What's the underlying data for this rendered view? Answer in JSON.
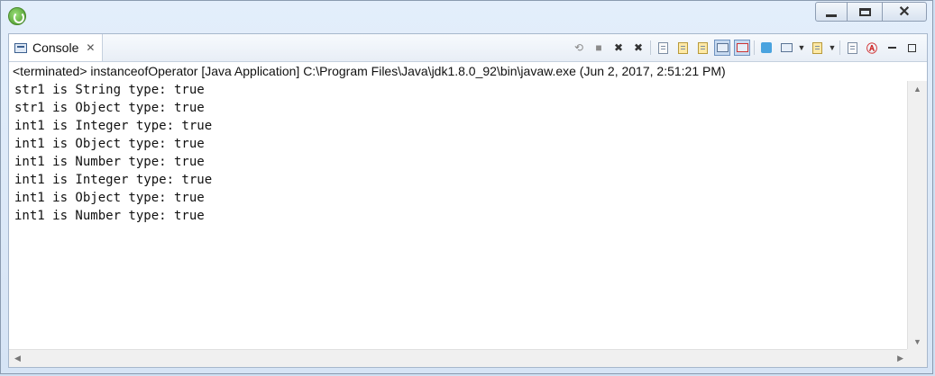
{
  "window": {
    "controls": [
      "minimize",
      "maximize",
      "close"
    ]
  },
  "tab": {
    "label": "Console",
    "close": "✕"
  },
  "toolbar": {
    "icons": [
      "remove-launch-icon",
      "terminate-icon",
      "remove-all-terminated-icon",
      "remove-launch-x-icon",
      "clear-console-icon",
      "scroll-lock-icon",
      "word-wrap-icon",
      "show-on-stdout-icon",
      "show-on-stderr-icon",
      "pin-console-icon",
      "display-selected-console-icon",
      "open-console-icon",
      "view-menu-icon",
      "link-icon",
      "minimize-view-icon",
      "maximize-view-icon"
    ]
  },
  "status": "<terminated> instanceofOperator [Java Application] C:\\Program Files\\Java\\jdk1.8.0_92\\bin\\javaw.exe (Jun 2, 2017, 2:51:21 PM)",
  "output": [
    "str1 is String type: true",
    "str1 is Object type: true",
    "int1 is Integer type: true",
    "int1 is Object type: true",
    "int1 is Number type: true",
    "int1 is Integer type: true",
    "int1 is Object type: true",
    "int1 is Number type: true"
  ]
}
